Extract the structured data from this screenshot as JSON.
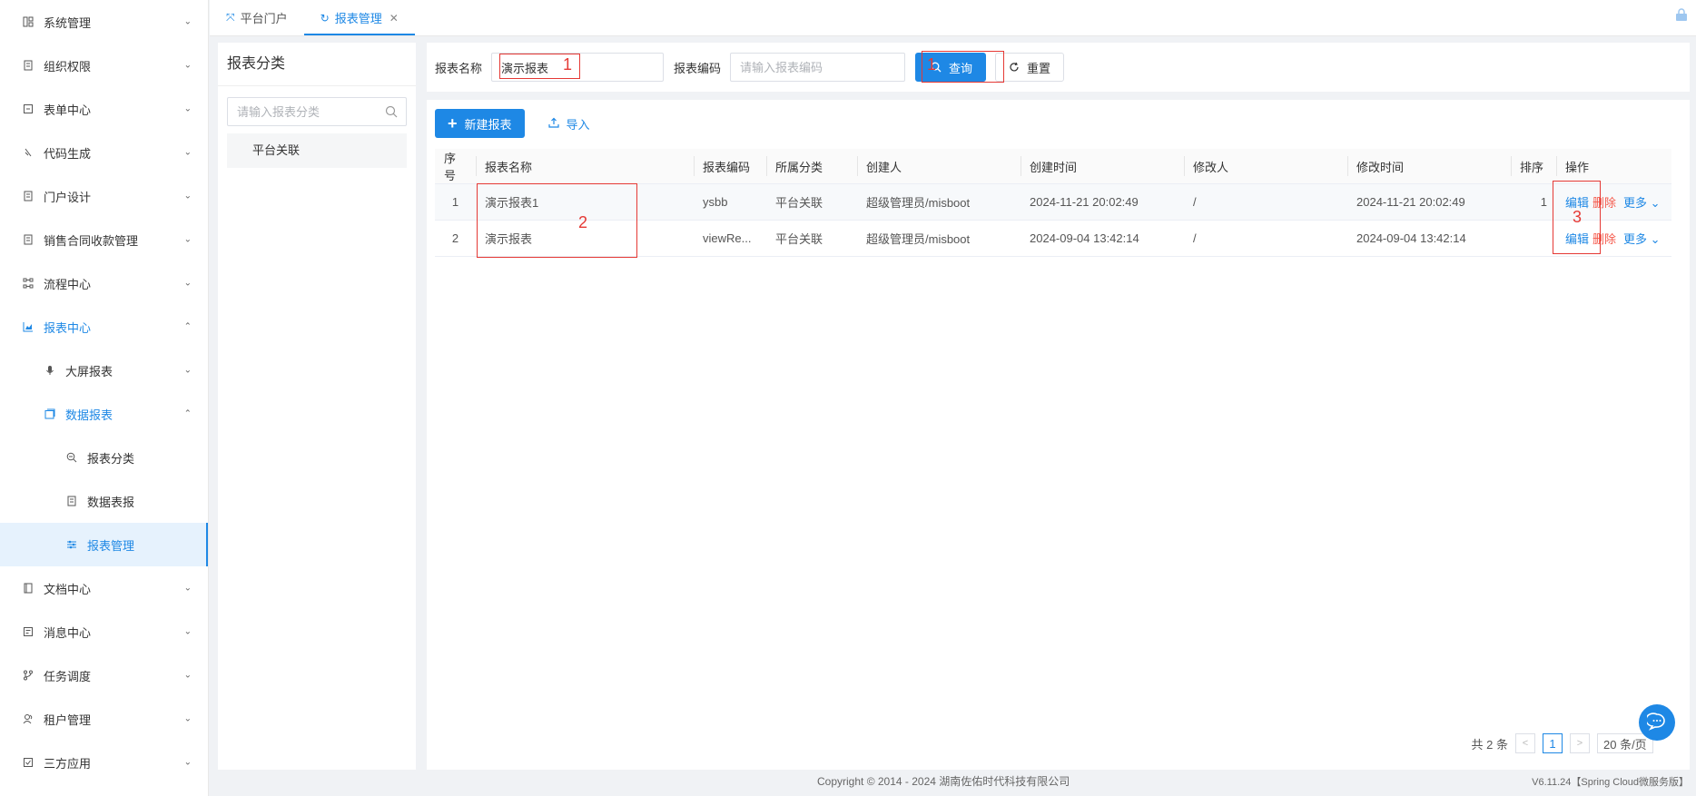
{
  "sidebar": {
    "items": [
      {
        "label": "系统管理",
        "icon": "grid-icon"
      },
      {
        "label": "组织权限",
        "icon": "doc-icon"
      },
      {
        "label": "表单中心",
        "icon": "form-icon"
      },
      {
        "label": "代码生成",
        "icon": "code-icon"
      },
      {
        "label": "门户设计",
        "icon": "doc-icon"
      },
      {
        "label": "销售合同收款管理",
        "icon": "doc-icon"
      },
      {
        "label": "流程中心",
        "icon": "flow-icon"
      },
      {
        "label": "报表中心",
        "icon": "chart-icon"
      },
      {
        "label": "大屏报表",
        "icon": "mic-icon"
      },
      {
        "label": "数据报表",
        "icon": "window-icon"
      },
      {
        "label": "报表分类",
        "icon": "search-icon"
      },
      {
        "label": "数据表报",
        "icon": "doc-icon"
      },
      {
        "label": "报表管理",
        "icon": "sliders-icon"
      },
      {
        "label": "文档中心",
        "icon": "book-icon"
      },
      {
        "label": "消息中心",
        "icon": "message-icon"
      },
      {
        "label": "任务调度",
        "icon": "branch-icon"
      },
      {
        "label": "租户管理",
        "icon": "users-icon"
      },
      {
        "label": "三方应用",
        "icon": "check-square-icon"
      }
    ]
  },
  "tabs": [
    {
      "label": "平台门户"
    },
    {
      "label": "报表管理"
    }
  ],
  "category": {
    "title": "报表分类",
    "search_placeholder": "请输入报表分类",
    "nodes": [
      "平台关联"
    ]
  },
  "search": {
    "name_label": "报表名称",
    "name_value": "演示报表",
    "code_label": "报表编码",
    "code_placeholder": "请输入报表编码",
    "query_label": "查询",
    "reset_label": "重置"
  },
  "toolbar": {
    "new_label": "新建报表",
    "import_label": "导入"
  },
  "table": {
    "headers": [
      "序号",
      "报表名称",
      "报表编码",
      "所属分类",
      "创建人",
      "创建时间",
      "修改人",
      "修改时间",
      "排序",
      "操作"
    ],
    "rows": [
      {
        "index": "1",
        "name": "演示报表1",
        "code": "ysbb",
        "category": "平台关联",
        "creator": "超级管理员/misboot",
        "created": "2024-11-21 20:02:49",
        "modifier": "/",
        "modified": "2024-11-21 20:02:49",
        "sort": "1"
      },
      {
        "index": "2",
        "name": "演示报表",
        "code": "viewRe...",
        "category": "平台关联",
        "creator": "超级管理员/misboot",
        "created": "2024-09-04 13:42:14",
        "modifier": "/",
        "modified": "2024-09-04 13:42:14",
        "sort": ""
      }
    ],
    "op_edit": "编辑",
    "op_delete": "删除",
    "op_more": "更多"
  },
  "annotations": [
    "1",
    "1",
    "2",
    "3"
  ],
  "pager": {
    "total": "共 2 条",
    "current": "1",
    "size": "20 条/页"
  },
  "footer": {
    "copyright": "Copyright © 2014 - 2024 湖南佐佑时代科技有限公司",
    "version": "V6.11.24【Spring Cloud微服务版】"
  },
  "colors": {
    "primary": "#1e88e5",
    "danger": "#f5594b",
    "annotation": "#e53935"
  }
}
